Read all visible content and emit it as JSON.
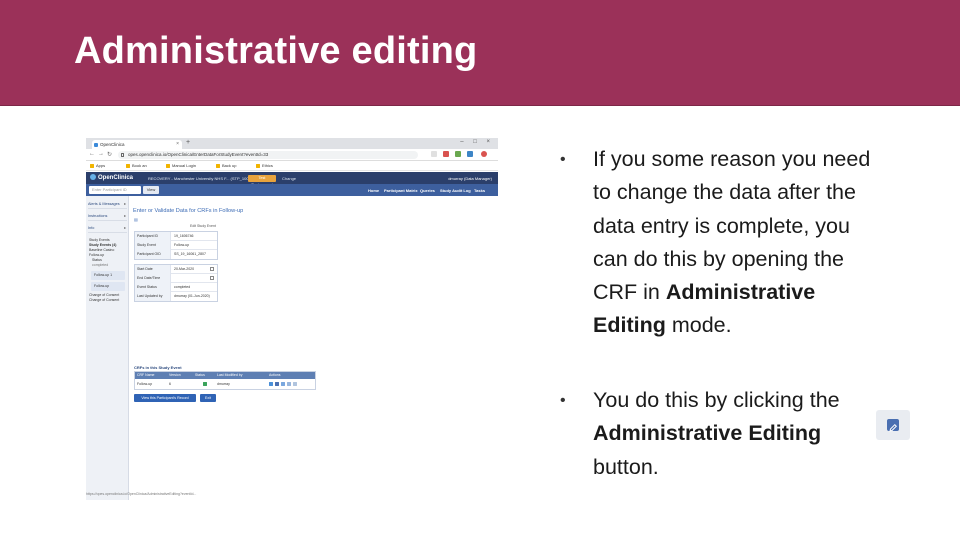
{
  "slide": {
    "title": "Administrative editing",
    "bullets": [
      {
        "pre": "If you some reason you need to change the data after the data entry is complete, you can do this by opening the CRF in ",
        "bold": "Administrative Editing",
        "post": " mode."
      },
      {
        "pre": "You do this by clicking the ",
        "bold": "Administrative Editing",
        "post": " button."
      }
    ],
    "bullet_char": "•"
  },
  "screenshot": {
    "browser": {
      "tab_title": "OpenClinica",
      "tab_close": "×",
      "new_tab": "+",
      "window_controls": "– □ ×",
      "url": "opes.openclinica.io/OpenClinica/EnterDataForStudyEvent?eventId=33",
      "bookmarks": [
        "Apps",
        "Book an",
        "Manual Login",
        "Back up",
        "Ethics"
      ]
    },
    "app": {
      "logo": "OpenClinica",
      "study": "RECOVERY - Manchester University NHS F... (STP_1001)",
      "environment": "Test Environment",
      "change": "Change",
      "user": "dmurray (Data Manager)",
      "search_placeholder": "Enter Participant ID",
      "view_button": "View",
      "menu": [
        "Home",
        "Participant Matrix",
        "Queries",
        "Study Audit Log",
        "Tasks"
      ]
    },
    "sidebar": {
      "sections": [
        "Alerts & Messages",
        "Instructions",
        "Info"
      ],
      "lines": [
        "Study Events",
        "Study Events (4)",
        "Baseline Casino",
        "Follow-up",
        "Status",
        "completed"
      ],
      "selected_1": "Follow-up 1",
      "selected_2": "Follow-up",
      "lines_after": [
        "Change of Consent",
        "Change of Consent"
      ]
    },
    "main": {
      "heading": "Enter or Validate Data for CRFs in Follow-up",
      "link": "▤",
      "edit_event": "Edit Study Event",
      "participant": [
        {
          "k": "Participant ID",
          "v": "19_1606746"
        },
        {
          "k": "Study Event",
          "v": "Follow-up"
        },
        {
          "k": "Participant OID",
          "v": "SS_19_16061_2807"
        }
      ],
      "event": [
        {
          "k": "Start Date",
          "v": "20-Mar-2020"
        },
        {
          "k": "End Date/Time",
          "v": ""
        },
        {
          "k": "Event Status",
          "v": "completed"
        },
        {
          "k": "Last Updated by",
          "v": "dmurray (01-Jun-2020)"
        }
      ],
      "crfs_title": "CRFs in this Study Event",
      "crf_headers": [
        "CRF Name",
        "Version",
        "Status",
        "Last Modified by",
        "Actions"
      ],
      "crf_row": [
        "Follow-up",
        "6",
        "",
        "dmurray",
        ""
      ],
      "buttons": [
        "View this Participant's Record",
        "Exit"
      ]
    },
    "status_url": "https://opes.openclinica.io/OpenClinica/AdministrativeEditing?eventId..."
  },
  "colors": {
    "banner": "#9b3159",
    "oc_header": "#2b3f6b",
    "oc_nav": "#3d5f9e",
    "accent_blue": "#2f63b5"
  }
}
